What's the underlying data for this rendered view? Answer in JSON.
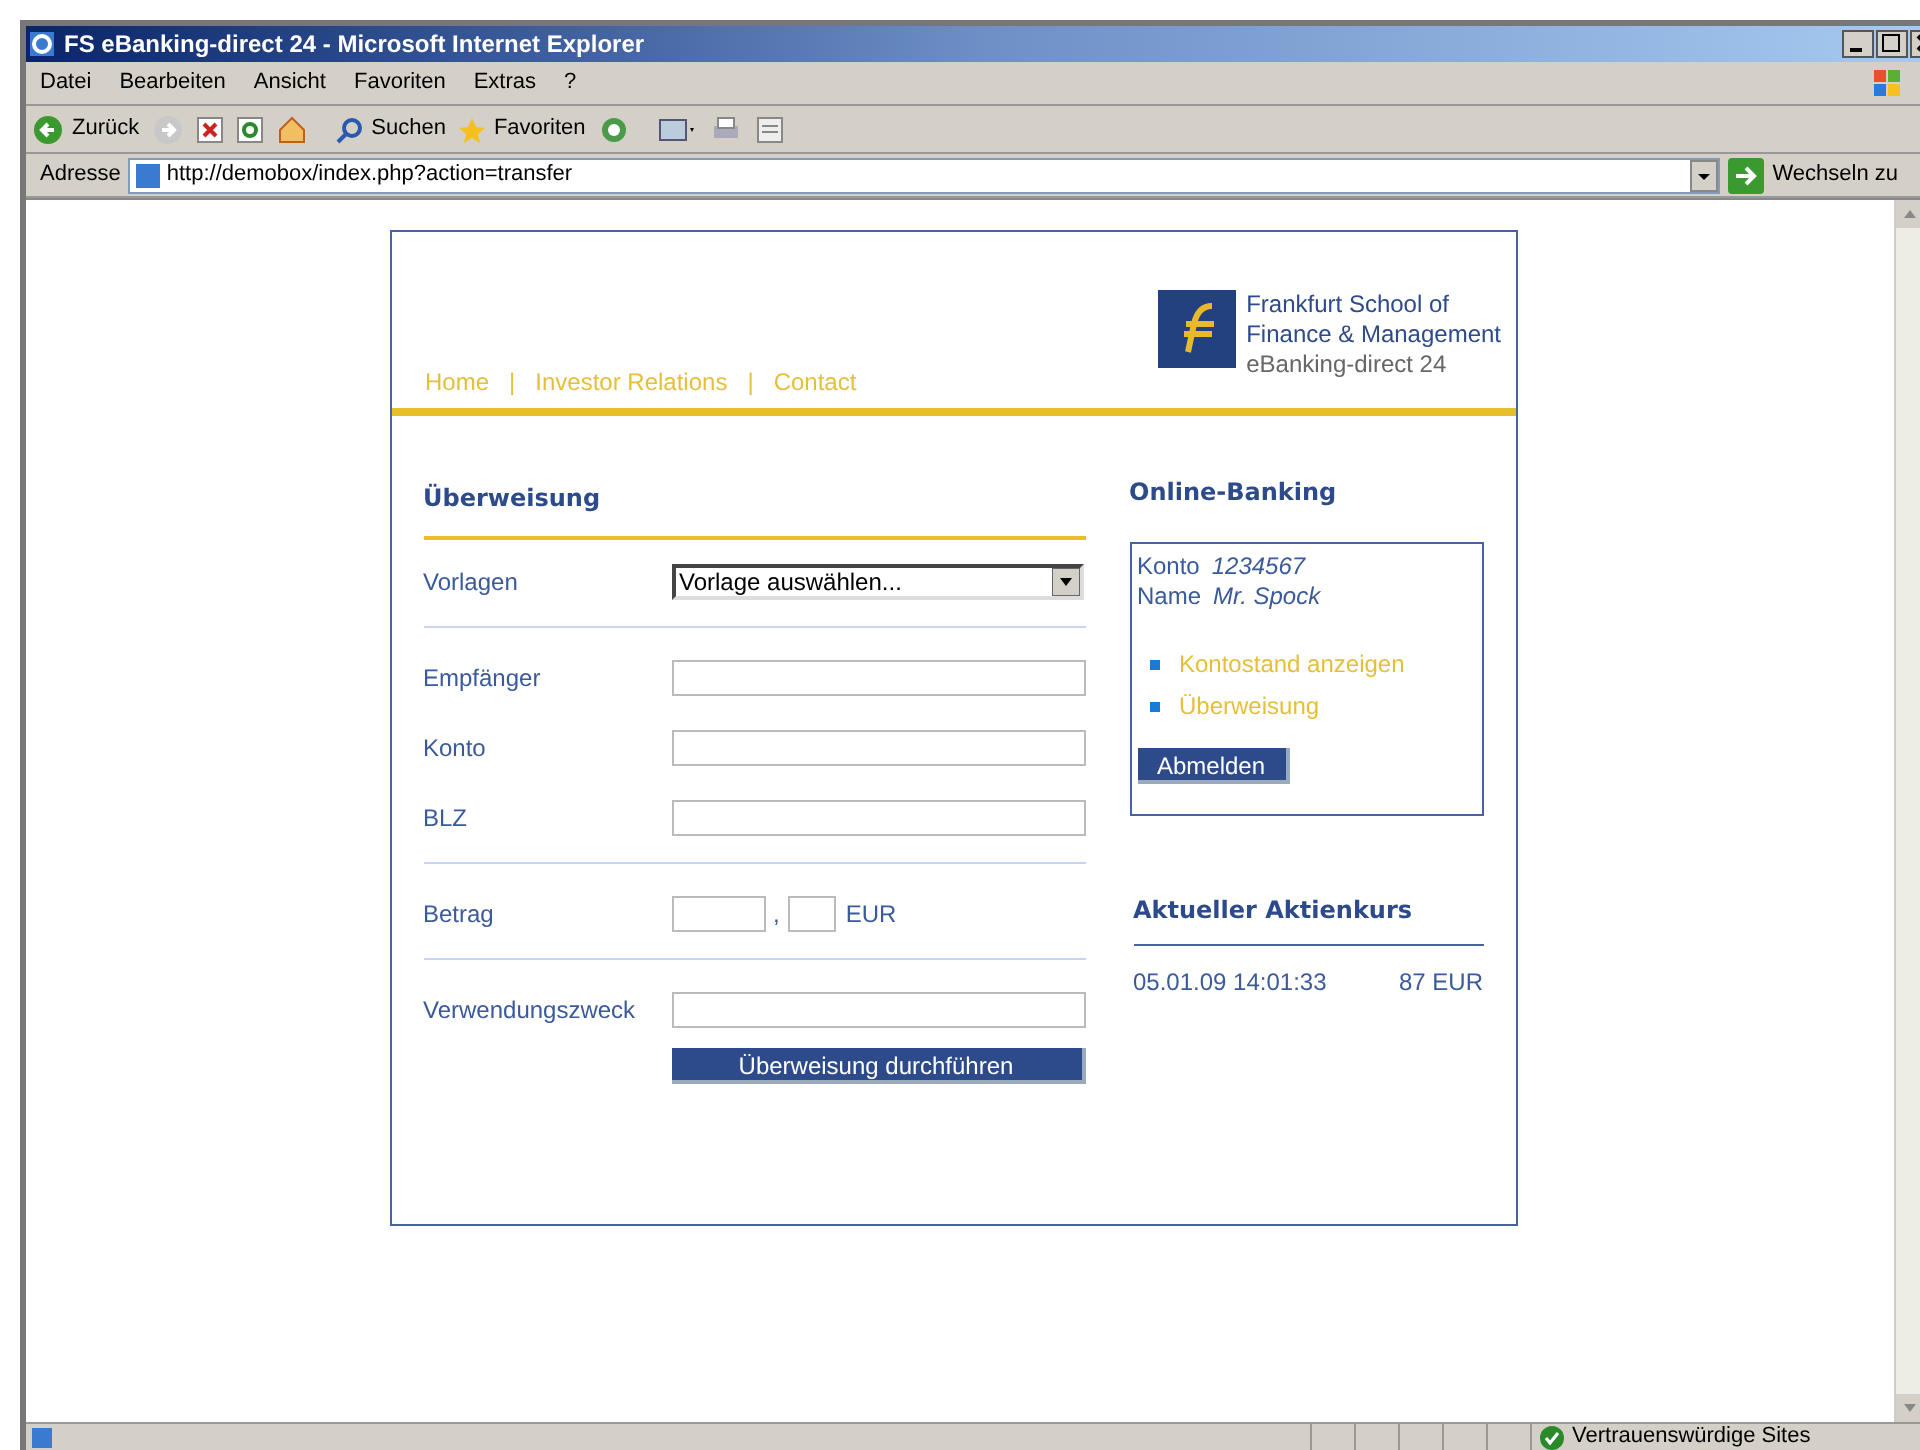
{
  "window": {
    "title": "FS eBanking-direct 24 - Microsoft Internet Explorer"
  },
  "menu": [
    "Datei",
    "Bearbeiten",
    "Ansicht",
    "Favoriten",
    "Extras",
    "?"
  ],
  "toolbar": {
    "back": "Zurück",
    "search": "Suchen",
    "favorites": "Favoriten"
  },
  "address_bar": {
    "label": "Adresse",
    "url": "http://demobox/index.php?action=transfer",
    "go": "Wechseln zu"
  },
  "page": {
    "nav": {
      "links": [
        "Home",
        "Investor Relations",
        "Contact"
      ],
      "separator": "|"
    },
    "logo": {
      "lines": [
        "Frankfurt School of",
        "Finance & Management"
      ],
      "subtitle": "eBanking-direct 24"
    },
    "form": {
      "title": "Überweisung",
      "groups": [
        [
          {
            "kind": "select",
            "label": "Vorlagen",
            "value": "Vorlage auswählen..."
          }
        ],
        [
          {
            "kind": "text",
            "label": "Empfänger"
          },
          {
            "kind": "text",
            "label": "Konto"
          },
          {
            "kind": "text",
            "label": "BLZ"
          }
        ],
        [
          {
            "kind": "amount",
            "label": "Betrag",
            "separator": ",",
            "currency": "EUR"
          }
        ],
        [
          {
            "kind": "text",
            "label": "Verwendungszweck"
          }
        ]
      ],
      "submit": "Überweisung durchführen"
    },
    "online_banking": {
      "title": "Online-Banking",
      "account": [
        {
          "label": "Konto",
          "value": "1234567"
        },
        {
          "label": "Name",
          "value": "Mr. Spock"
        }
      ],
      "links": [
        "Kontostand anzeigen",
        "Überweisung"
      ],
      "logout": "Abmelden"
    },
    "stock": {
      "title": "Aktueller Aktienkurs",
      "time": "05.01.09 14:01:33",
      "price": "87 EUR"
    }
  },
  "status_bar": {
    "zone": "Vertrauenswürdige Sites"
  }
}
